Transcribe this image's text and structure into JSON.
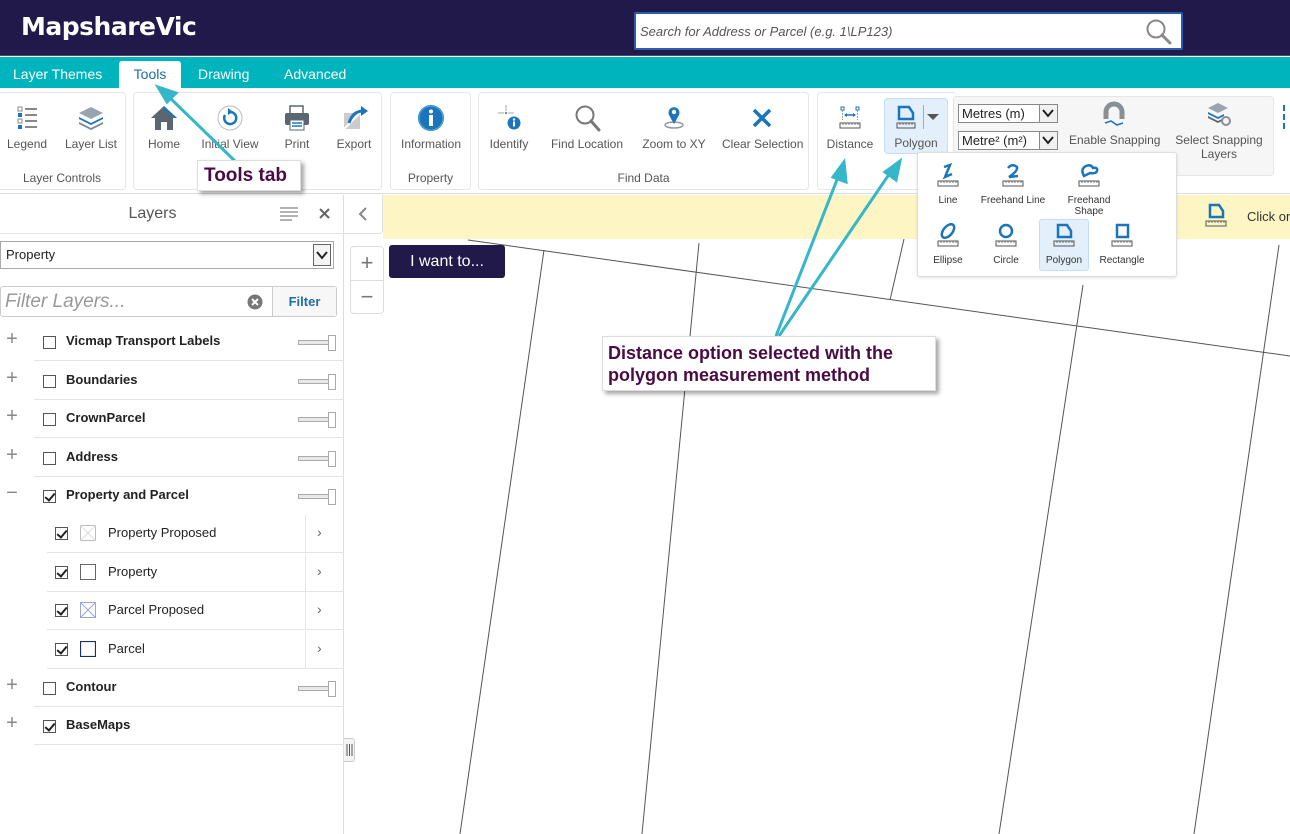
{
  "app": {
    "title": "MapshareVic",
    "search_placeholder": "Search for Address or Parcel (e.g. 1\\LP123)"
  },
  "tabs": [
    {
      "label": "Layer Themes",
      "active": false
    },
    {
      "label": "Tools",
      "active": true
    },
    {
      "label": "Drawing",
      "active": false
    },
    {
      "label": "Advanced",
      "active": false
    }
  ],
  "ribbon": {
    "groups": {
      "layer_controls": {
        "title": "Layer Controls",
        "buttons": [
          "Legend",
          "Layer List"
        ]
      },
      "navigation": {
        "title": "",
        "buttons": [
          "Home",
          "Initial View",
          "Print",
          "Export"
        ]
      },
      "property": {
        "title": "Property",
        "buttons": [
          "Information"
        ]
      },
      "find_data": {
        "title": "Find Data",
        "buttons": [
          "Identify",
          "Find Location",
          "Zoom to XY",
          "Clear Selection"
        ]
      },
      "measure": {
        "distance_label": "Distance",
        "polygon_label": "Polygon",
        "length_unit": "Metres (m)",
        "area_unit": "Metre² (m²)",
        "enable_snapping": "Enable Snapping",
        "select_snapping_layers": "Select Snapping Layers"
      }
    }
  },
  "measure_menu": {
    "items": [
      {
        "label": "Line",
        "icon": "line-measure-icon"
      },
      {
        "label": "Freehand Line",
        "icon": "freehand-line-icon"
      },
      {
        "label": "Freehand Shape",
        "icon": "freehand-shape-icon"
      },
      {
        "label": "Ellipse",
        "icon": "ellipse-icon"
      },
      {
        "label": "Circle",
        "icon": "circle-icon"
      },
      {
        "label": "Polygon",
        "icon": "polygon-icon",
        "selected": true
      },
      {
        "label": "Rectangle",
        "icon": "rectangle-icon"
      }
    ]
  },
  "layers_panel": {
    "title": "Layers",
    "theme_select": "Property",
    "filter_placeholder": "Filter Layers...",
    "filter_button": "Filter",
    "layers": [
      {
        "name": "Vicmap Transport Labels",
        "checked": false,
        "expanded": false,
        "opacity": 100
      },
      {
        "name": "Boundaries",
        "checked": false,
        "expanded": false,
        "opacity": 100
      },
      {
        "name": "CrownParcel",
        "checked": false,
        "expanded": false,
        "opacity": 100
      },
      {
        "name": "Address",
        "checked": false,
        "expanded": false,
        "opacity": 100
      },
      {
        "name": "Property and Parcel",
        "checked": true,
        "expanded": true,
        "opacity": 100
      },
      {
        "name": "Contour",
        "checked": false,
        "expanded": false,
        "opacity": 100
      },
      {
        "name": "BaseMaps",
        "checked": true,
        "expanded": false
      }
    ],
    "sublayers": [
      {
        "name": "Property Proposed",
        "checked": true
      },
      {
        "name": "Property",
        "checked": true
      },
      {
        "name": "Parcel Proposed",
        "checked": true
      },
      {
        "name": "Parcel",
        "checked": true
      }
    ]
  },
  "map": {
    "info_text": "Click or ta",
    "i_want_to": "I want to..."
  },
  "annotations": {
    "tools_tab": "Tools tab",
    "distance_note_line1": "Distance option selected with the",
    "distance_note_line2": "polygon measurement method",
    "arrow_color": "#35b6c9"
  },
  "colors": {
    "header_bg": "#20194a",
    "tabbar_bg": "#00b4bd",
    "accent_blue": "#1e6ea8",
    "icon_blue": "#1b75bc",
    "info_bar": "#fdf5c4",
    "callout_text": "#4a0b44"
  }
}
